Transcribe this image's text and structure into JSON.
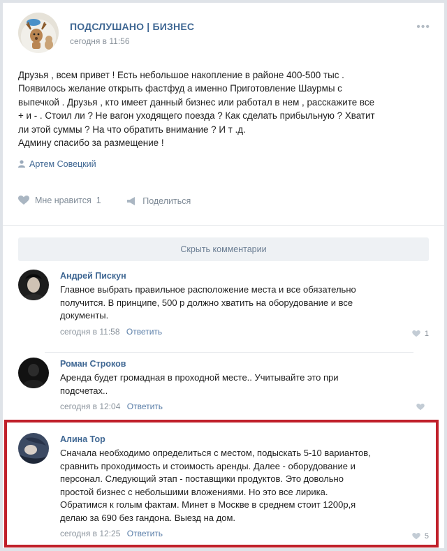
{
  "post": {
    "group_name": "ПОДСЛУШАНО | БИЗНЕС",
    "time": "сегодня в 11:56",
    "menu_icon": "more-dots-icon",
    "text_lines": [
      "Друзья , всем привет ! Есть небольшое накопление в районе 400-500 тыс .",
      "Появилось желание открыть фастфуд а именно Приготовление Шаурмы с",
      "выпечкой . Друзья , кто имеет данный бизнес или работал в нем , расскажите все",
      "+ и - . Стоил ли ? Не вагон уходящего поезда ? Как сделать прибыльную ? Хватит",
      "ли этой суммы ? На что обратить внимание ? И т .д.",
      "Админу спасибо за размещение !"
    ],
    "signer": "Артем Совецкий",
    "like_label": "Мне нравится",
    "like_count": "1",
    "share_label": "Поделиться"
  },
  "hide_comments_label": "Скрыть комментарии",
  "reply_label": "Ответить",
  "comments": [
    {
      "author": "Андрей Пискун",
      "lines": [
        "Главное выбрать правильное расположение места и все обязательно",
        "получится. В принципе, 500 р должно хватить на оборудование и все",
        "документы."
      ],
      "time": "сегодня в 11:58",
      "likes": "1"
    },
    {
      "author": "Роман Строков",
      "lines": [
        "Аренда будет громадная в проходной месте.. Учитывайте это при",
        "подсчетах.."
      ],
      "time": "сегодня в 12:04",
      "likes": ""
    },
    {
      "author": "Алина Тор",
      "lines": [
        "Сначала необходимо определиться с местом, подыскать 5-10 вариантов,",
        "сравнить проходимость и стоимость аренды. Далее - оборудование и",
        "персонал. Следующий этап - поставщики продуктов. Это довольно",
        "простой бизнес с небольшими вложениями. Но это все лирика.",
        "Обратимся к голым фактам. Минет в Москве в среднем стоит 1200р,я",
        "делаю за 690 без гандона. Выезд на дом."
      ],
      "time": "сегодня в 12:25",
      "likes": "5"
    }
  ],
  "colors": {
    "link": "#3f6793",
    "highlight": "#c0202a",
    "muted": "#8a939c"
  }
}
